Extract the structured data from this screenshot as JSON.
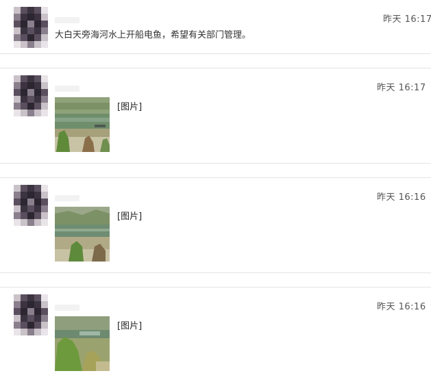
{
  "messages": [
    {
      "time": "昨天 16:17",
      "text": "大白天旁海河水上开船电鱼，希望有关部门管理。"
    },
    {
      "time": "昨天 16:17",
      "image_label": "[图片]"
    },
    {
      "time": "昨天 16:16",
      "image_label": "[图片]"
    },
    {
      "time": "昨天 16:16",
      "image_label": "[图片]"
    }
  ],
  "colors": {
    "divider": "#e3e3e3",
    "avatar_palette": [
      "#3b3340",
      "#5a4f5e",
      "#8a7f8c",
      "#c9c2c8",
      "#e9e4e8",
      "#2b2630"
    ]
  }
}
